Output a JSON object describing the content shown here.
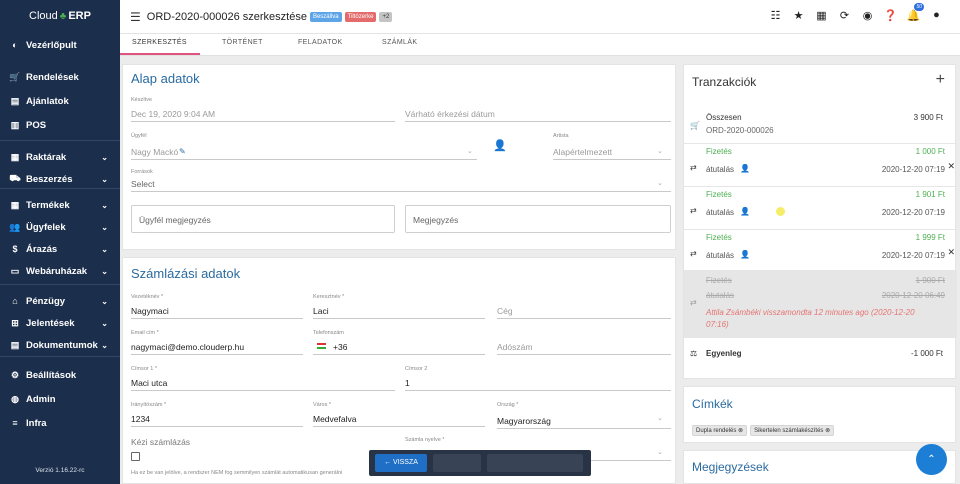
{
  "app": {
    "brand_left": "Cloud",
    "brand_right": "ERP",
    "version": "Verzió 1.16.22-rc"
  },
  "sidebar": {
    "items": [
      {
        "label": "Vezérlőpult",
        "icon": "palette-icon",
        "chevron": false
      },
      {
        "label": "Rendelések",
        "icon": "cart-icon",
        "chevron": false
      },
      {
        "label": "Ajánlatok",
        "icon": "document-icon",
        "chevron": false
      },
      {
        "label": "POS",
        "icon": "barcode-icon",
        "chevron": false
      },
      {
        "label": "Raktárak",
        "icon": "warehouse-icon",
        "chevron": true
      },
      {
        "label": "Beszerzés",
        "icon": "truck-icon",
        "chevron": true
      },
      {
        "label": "Termékek",
        "icon": "products-icon",
        "chevron": true
      },
      {
        "label": "Ügyfelek",
        "icon": "users-icon",
        "chevron": true
      },
      {
        "label": "Árazás",
        "icon": "dollar-icon",
        "chevron": true
      },
      {
        "label": "Webáruházak",
        "icon": "store-icon",
        "chevron": true
      },
      {
        "label": "Pénzügy",
        "icon": "bank-icon",
        "chevron": true
      },
      {
        "label": "Jelentések",
        "icon": "table-icon",
        "chevron": true
      },
      {
        "label": "Dokumentumok",
        "icon": "file-icon",
        "chevron": true
      },
      {
        "label": "Beállítások",
        "icon": "gear-icon",
        "chevron": false
      },
      {
        "label": "Admin",
        "icon": "admin-icon",
        "chevron": false
      },
      {
        "label": "Infra",
        "icon": "list-icon",
        "chevron": false
      }
    ]
  },
  "header": {
    "title": "ORD-2020-000026 szerkesztése",
    "badge1": "Beszállva",
    "badge2": "Tiltózerke",
    "badge3": "+2",
    "notif_count": "50"
  },
  "tabs": [
    "SZERKESZTÉS",
    "TÖRTÉNET",
    "FELADATOK",
    "SZÁMLÁK"
  ],
  "basic": {
    "title": "Alap adatok",
    "created_label": "Készítve",
    "created_value": "Dec 19, 2020 9:04 AM",
    "expected_placeholder": "Várható érkezési dátum",
    "customer_label": "Ügyfél",
    "customer_value": "Nagy Mackó",
    "agent_label": "Artista",
    "agent_value": "Alapértelmezett",
    "source_label": "Források",
    "source_value": "Select",
    "customer_note": "Ügyfél megjegyzés",
    "note": "Megjegyzés"
  },
  "billing": {
    "title": "Számlázási adatok",
    "lastname_label": "Vezetéknév *",
    "lastname": "Nagymaci",
    "firstname_label": "Keresztnév *",
    "firstname": "Laci",
    "company_placeholder": "Cég",
    "email_label": "Email cím *",
    "email": "nagymaci@demo.clouderp.hu",
    "phone_label": "Telefonszám",
    "phone": "+36",
    "tax_placeholder": "Adószám",
    "addr1_label": "Címsor 1 *",
    "addr1": "Maci utca",
    "addr2_label": "Címsor 2",
    "addr2": "1",
    "zip_label": "Irányítószám *",
    "zip": "1234",
    "city_label": "Város *",
    "city": "Medvefalva",
    "country_label": "Ország *",
    "country": "Magyarország",
    "manual_label": "Kézi számlázás",
    "lang_label": "Számla nyelve *",
    "help": "Ha ez be van jelölve, a rendszer NEM fog semmilyen számlát automatikusan generálni"
  },
  "transactions": {
    "title": "Tranzakciók",
    "total_label": "Összesen",
    "total_ref": "ORD-2020-000026",
    "total_value": "3 900 Ft",
    "items": [
      {
        "type": "Fizetés",
        "method": "átutalás",
        "amount": "1 000 Ft",
        "date": "2020-12-20 07:19"
      },
      {
        "type": "Fizetés",
        "method": "átutalás",
        "amount": "1 901 Ft",
        "date": "2020-12-20 07:19"
      },
      {
        "type": "Fizetés",
        "method": "átutalás",
        "amount": "1 999 Ft",
        "date": "2020-12-20 07:19"
      }
    ],
    "cancelled": {
      "type": "Fizetés",
      "method": "átutalás",
      "amount": "1 900 Ft",
      "date": "2020-12-20 06:49",
      "note": "Attila Zsámbéki visszamondta 12 minutes ago (2020-12-20 07:16)"
    },
    "balance_label": "Egyenleg",
    "balance_value": "-1 000 Ft"
  },
  "tags": {
    "title": "Címkék",
    "items": [
      "Dupla rendelés",
      "Sikertelen számlakészítés"
    ]
  },
  "notes": {
    "title": "Megjegyzések"
  },
  "bottom": {
    "back": "← VISSZA"
  },
  "colors": {
    "sidebar": "#1b2e4b",
    "accent": "#2a6ba0",
    "tab_underline": "#e0537e",
    "green": "#4caf50",
    "fab": "#1d7ed6"
  }
}
